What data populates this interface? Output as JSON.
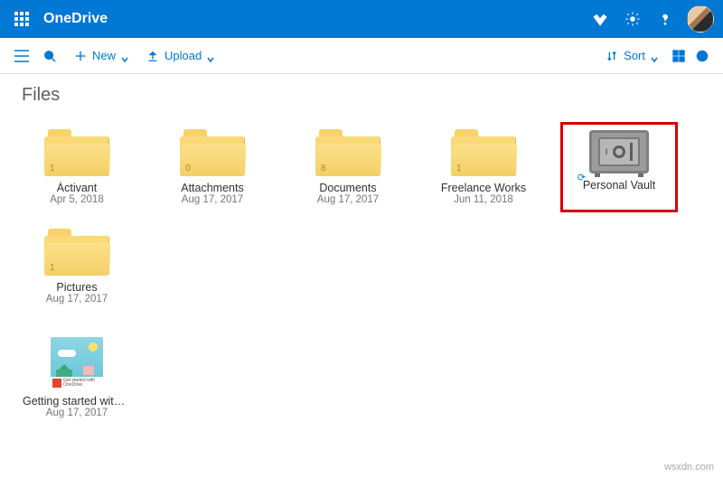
{
  "header": {
    "brand": "OneDrive"
  },
  "cmdbar": {
    "new_label": "New",
    "upload_label": "Upload",
    "sort_label": "Sort"
  },
  "page": {
    "title": "Files"
  },
  "items": [
    {
      "name": "Áctivant",
      "date": "Apr 5, 2018",
      "count": "1",
      "kind": "folder"
    },
    {
      "name": "Attachments",
      "date": "Aug 17, 2017",
      "count": "0",
      "kind": "folder"
    },
    {
      "name": "Documents",
      "date": "Aug 17, 2017",
      "count": "8",
      "kind": "folder"
    },
    {
      "name": "Freelance Works",
      "date": "Jun 11, 2018",
      "count": "1",
      "kind": "folder"
    },
    {
      "name": "Personal Vault",
      "date": "",
      "count": "",
      "kind": "vault"
    },
    {
      "name": "Pictures",
      "date": "Aug 17, 2017",
      "count": "1",
      "kind": "folder"
    },
    {
      "name": "Getting started with OneD…",
      "date": "Aug 17, 2017",
      "count": "",
      "kind": "file"
    }
  ],
  "watermark": "wsxdn.com"
}
